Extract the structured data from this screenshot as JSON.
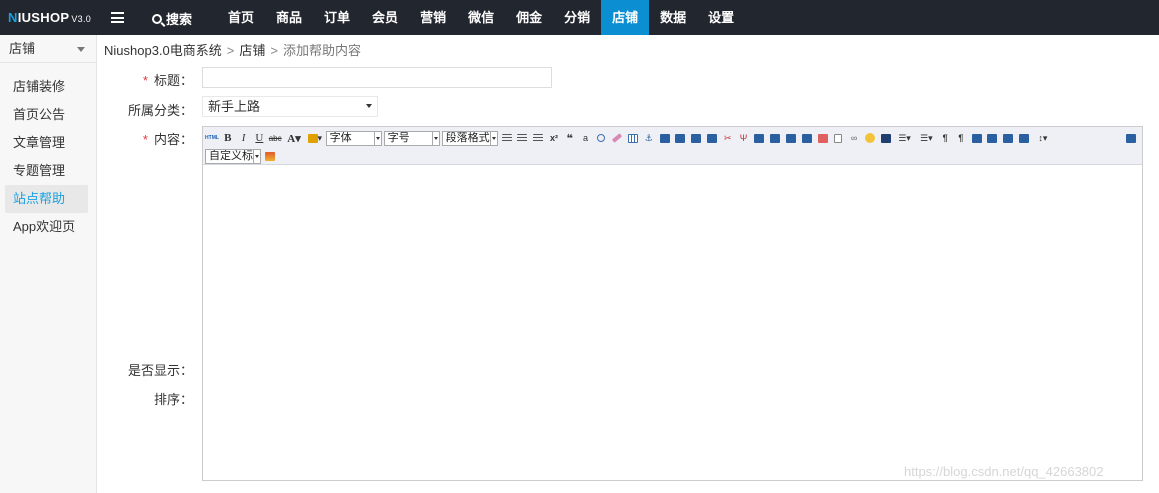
{
  "logo": {
    "brand_initial": "N",
    "brand_rest": "IUSHOP",
    "version": "V3.0"
  },
  "topbar": {
    "search_label": "搜索",
    "nav": [
      {
        "label": "首页",
        "active": false
      },
      {
        "label": "商品",
        "active": false
      },
      {
        "label": "订单",
        "active": false
      },
      {
        "label": "会员",
        "active": false
      },
      {
        "label": "营销",
        "active": false
      },
      {
        "label": "微信",
        "active": false
      },
      {
        "label": "佣金",
        "active": false
      },
      {
        "label": "分销",
        "active": false
      },
      {
        "label": "店铺",
        "active": true
      },
      {
        "label": "数据",
        "active": false
      },
      {
        "label": "设置",
        "active": false
      }
    ]
  },
  "sidebar": {
    "header": "店铺",
    "items": [
      {
        "label": "店铺装修",
        "active": false
      },
      {
        "label": "首页公告",
        "active": false
      },
      {
        "label": "文章管理",
        "active": false
      },
      {
        "label": "专题管理",
        "active": false
      },
      {
        "label": "站点帮助",
        "active": true
      },
      {
        "label": "App欢迎页",
        "active": false
      }
    ]
  },
  "breadcrumb": {
    "root": "Niushop3.0电商系统",
    "section": "店铺",
    "current": "添加帮助内容",
    "separator": ">"
  },
  "form": {
    "required_mark": "*",
    "title_label": "标题：",
    "title_value": "",
    "category_label": "所属分类：",
    "category_value": "新手上路",
    "content_label": "内容：",
    "display_label": "是否显示：",
    "sort_label": "排序："
  },
  "editor": {
    "font_family_select": "字体",
    "font_size_select": "字号",
    "paragraph_select": "段落格式",
    "custom_style_select": "自定义标题",
    "buttons_row1": [
      "html-icon",
      "bold-icon",
      "italic-icon",
      "underline-icon",
      "strikethrough-icon",
      "font-color-icon",
      "highlight-icon"
    ],
    "buttons_row1b": [
      "align-left-icon",
      "align-center-icon",
      "align-right-icon",
      "superscript-icon",
      "quote-icon",
      "spellcheck-icon",
      "find-icon",
      "eraser-icon",
      "table-icon",
      "anchor-icon",
      "insert-row-icon",
      "insert-col-icon",
      "merge-icon",
      "split-icon",
      "cut-icon",
      "paste-icon",
      "grid1-icon",
      "grid2-icon",
      "grid3-icon",
      "grid4-icon",
      "image-icon",
      "file-icon",
      "link-icon",
      "emoji-icon",
      "video-icon",
      "ordered-list-icon",
      "unordered-list-icon",
      "ltr-icon",
      "rtl-icon",
      "img-left-icon",
      "img-right-icon",
      "img-center-icon",
      "img-none-icon",
      "line-height-icon",
      "fullscreen-icon"
    ],
    "buttons_row2": [
      "insert-image-icon"
    ]
  },
  "watermark": "https://blog.csdn.net/qq_42663802",
  "colors": {
    "topbar": "#22262e",
    "active_nav": "#0c8fd2",
    "accent": "#1aa0e0",
    "required": "#e4393c"
  }
}
